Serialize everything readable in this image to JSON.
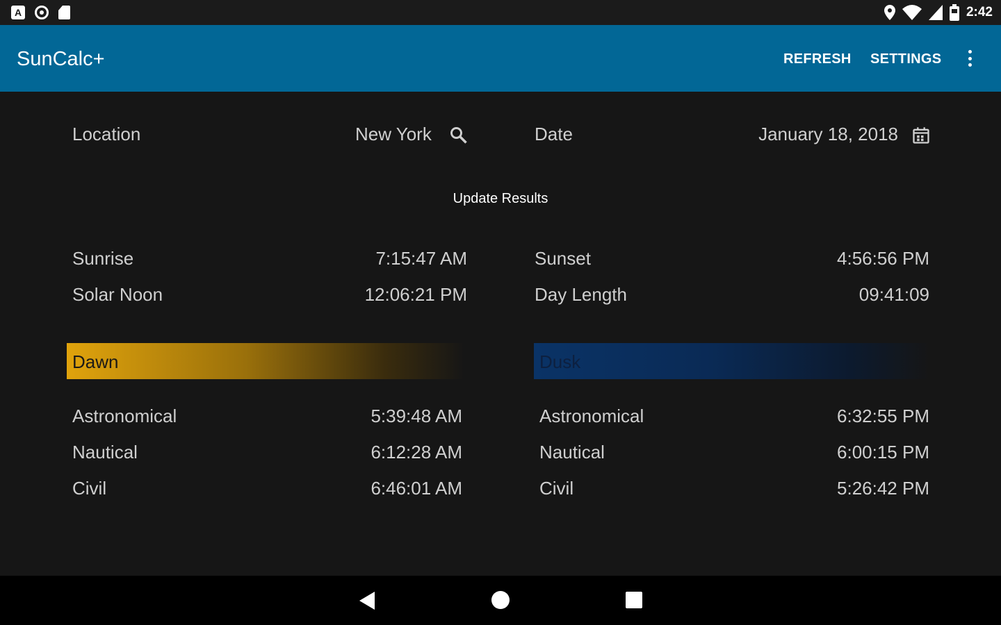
{
  "status_bar": {
    "time": "2:42",
    "left_icons": [
      "a-notification-icon",
      "circle-notification-icon",
      "sd-card-icon"
    ],
    "right_icons": [
      "location-pin-icon",
      "wifi-icon",
      "cell-signal-icon",
      "battery-icon"
    ]
  },
  "app_bar": {
    "title": "SunCalc+",
    "refresh_label": "REFRESH",
    "settings_label": "SETTINGS",
    "overflow_icon": "more-vert-icon",
    "background_color": "#026796"
  },
  "inputs": {
    "location_label": "Location",
    "location_value": "New York",
    "location_icon": "search-icon",
    "date_label": "Date",
    "date_value": "January 18, 2018",
    "date_icon": "calendar-icon"
  },
  "update_button": "Update Results",
  "summary": {
    "sunrise_label": "Sunrise",
    "sunrise_value": "7:15:47 AM",
    "solar_noon_label": "Solar Noon",
    "solar_noon_value": "12:06:21 PM",
    "sunset_label": "Sunset",
    "sunset_value": "4:56:56 PM",
    "day_length_label": "Day Length",
    "day_length_value": "09:41:09"
  },
  "dawn": {
    "header": "Dawn",
    "color": "#e0a30c",
    "rows": [
      {
        "label": "Astronomical",
        "value": "5:39:48 AM"
      },
      {
        "label": "Nautical",
        "value": "6:12:28 AM"
      },
      {
        "label": "Civil",
        "value": "6:46:01 AM"
      }
    ]
  },
  "dusk": {
    "header": "Dusk",
    "color": "#0a3366",
    "rows": [
      {
        "label": "Astronomical",
        "value": "6:32:55 PM"
      },
      {
        "label": "Nautical",
        "value": "6:00:15 PM"
      },
      {
        "label": "Civil",
        "value": "5:26:42 PM"
      }
    ]
  },
  "nav_bar": {
    "icons": [
      "back-icon",
      "home-icon",
      "recents-icon"
    ]
  }
}
